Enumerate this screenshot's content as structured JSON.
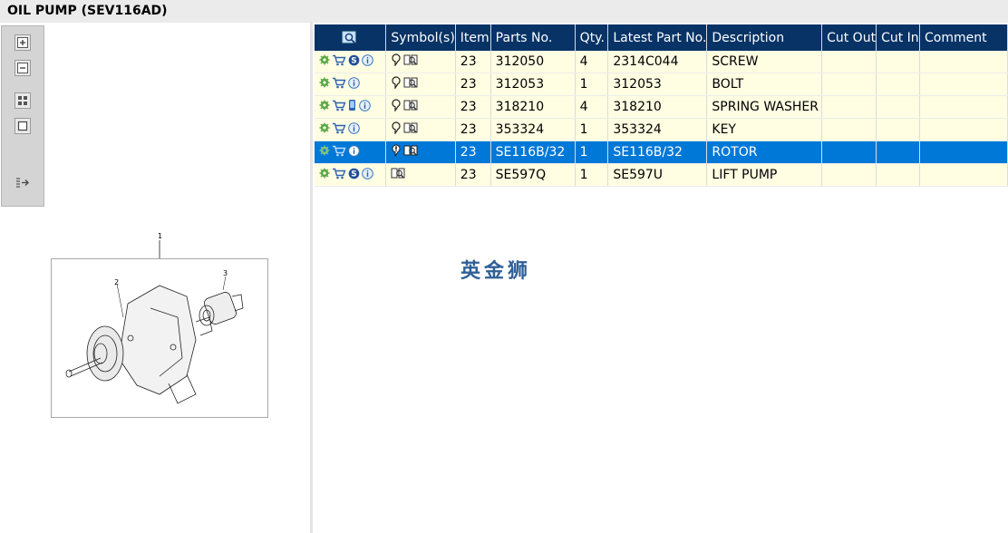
{
  "window": {
    "title": "OIL PUMP (SEV116AD)"
  },
  "toolbar": {
    "buttons": [
      {
        "name": "zoom-in",
        "icon": "plus-icon"
      },
      {
        "name": "zoom-out",
        "icon": "minus-icon"
      },
      {
        "name": "fit-all",
        "icon": "grid-icon"
      },
      {
        "name": "actual-size",
        "icon": "square-icon"
      },
      {
        "name": "export",
        "icon": "export-arrow-icon"
      }
    ]
  },
  "diagram": {
    "callouts": [
      "1",
      "2",
      "3"
    ]
  },
  "grid": {
    "columns": [
      "",
      "Symbol(s)",
      "Item",
      "Parts No.",
      "Qty.",
      "Latest Part No.",
      "Description",
      "Cut Out",
      "Cut In",
      "Comment"
    ],
    "rows": [
      {
        "action_icons": [
          "gear-icon",
          "cart-icon",
          "s-badge-icon",
          "info-icon"
        ],
        "symbol_icons": [
          "pin-icon",
          "book-icon"
        ],
        "item": "23",
        "parts_no": "312050",
        "qty": "4",
        "latest_part_no": "2314C044",
        "description": "SCREW",
        "cut_out": "",
        "cut_in": "",
        "comment": "",
        "selected": false
      },
      {
        "action_icons": [
          "gear-icon",
          "cart-icon",
          "info-icon"
        ],
        "symbol_icons": [
          "pin-icon",
          "book-icon"
        ],
        "item": "23",
        "parts_no": "312053",
        "qty": "1",
        "latest_part_no": "312053",
        "description": "BOLT",
        "cut_out": "",
        "cut_in": "",
        "comment": "",
        "selected": false
      },
      {
        "action_icons": [
          "gear-icon",
          "cart-icon",
          "phone-icon",
          "info-icon"
        ],
        "symbol_icons": [
          "pin-icon",
          "book-icon"
        ],
        "item": "23",
        "parts_no": "318210",
        "qty": "4",
        "latest_part_no": "318210",
        "description": "SPRING WASHER",
        "cut_out": "",
        "cut_in": "",
        "comment": "",
        "selected": false
      },
      {
        "action_icons": [
          "gear-icon",
          "cart-icon",
          "info-icon"
        ],
        "symbol_icons": [
          "pin-icon",
          "book-icon"
        ],
        "item": "23",
        "parts_no": "353324",
        "qty": "1",
        "latest_part_no": "353324",
        "description": "KEY",
        "cut_out": "",
        "cut_in": "",
        "comment": "",
        "selected": false
      },
      {
        "action_icons": [
          "gear-icon",
          "cart-icon",
          "info-icon"
        ],
        "symbol_icons": [
          "alert-pin-icon",
          "book-icon"
        ],
        "item": "23",
        "parts_no": "SE116B/32",
        "qty": "1",
        "latest_part_no": "SE116B/32",
        "description": "ROTOR",
        "cut_out": "",
        "cut_in": "",
        "comment": "",
        "selected": true
      },
      {
        "action_icons": [
          "gear-icon",
          "cart-icon",
          "s-badge-icon",
          "info-icon"
        ],
        "symbol_icons": [
          "book-icon"
        ],
        "item": "23",
        "parts_no": "SE597Q",
        "qty": "1",
        "latest_part_no": "SE597U",
        "description": "LIFT PUMP",
        "cut_out": "",
        "cut_in": "",
        "comment": "",
        "selected": false
      }
    ]
  },
  "watermark": {
    "text": "英金狮"
  },
  "colors": {
    "header_bg": "#073366",
    "row_bg": "#fffde2",
    "selected_bg": "#0078d7"
  }
}
